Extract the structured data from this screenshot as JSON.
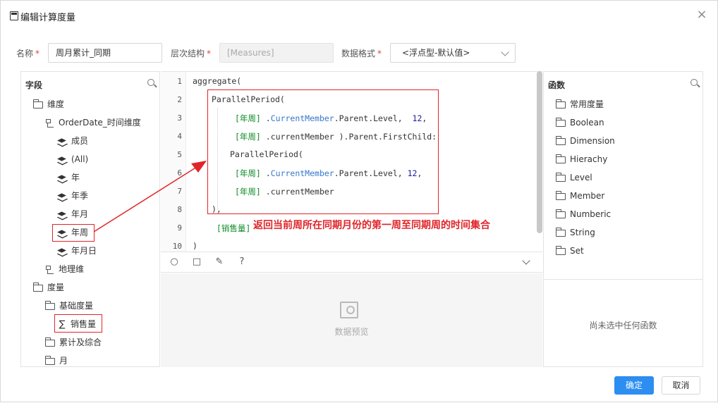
{
  "dialog": {
    "title": "编辑计算度量",
    "close": "×"
  },
  "form": {
    "name_label": "名称",
    "name_value": "周月累计_同期",
    "hier_label": "层次结构",
    "hier_value": "[Measures]",
    "format_label": "数据格式",
    "format_value": "<浮点型-默认值>",
    "required_mark": "*"
  },
  "fields_panel": {
    "title": "字段",
    "items": [
      {
        "label": "维度",
        "icon": "folder-icon"
      },
      {
        "label": "OrderDate_时间维度",
        "icon": "hierarchy-icon"
      },
      {
        "label": "成员",
        "icon": "layers-icon"
      },
      {
        "label": "(All)",
        "icon": "layers-icon"
      },
      {
        "label": "年",
        "icon": "layers-icon"
      },
      {
        "label": "年季",
        "icon": "layers-icon"
      },
      {
        "label": "年月",
        "icon": "layers-icon"
      },
      {
        "label": "年周",
        "icon": "layers-icon"
      },
      {
        "label": "年月日",
        "icon": "layers-icon"
      },
      {
        "label": "地理维",
        "icon": "hierarchy-icon"
      },
      {
        "label": "度量",
        "icon": "folder-icon"
      },
      {
        "label": "基础度量",
        "icon": "folder-icon"
      },
      {
        "label": "销售量",
        "icon": "sigma-icon"
      },
      {
        "label": "累计及综合",
        "icon": "folder-icon"
      },
      {
        "label": "月",
        "icon": "folder-icon"
      }
    ]
  },
  "editor": {
    "line_numbers": [
      "1",
      "2",
      "3",
      "4",
      "5",
      "6",
      "7",
      "8",
      "9",
      "10"
    ],
    "lines": {
      "l1": "aggregate(",
      "l2": "ParallelPeriod(",
      "l3a": "[年周]",
      "l3b": " .",
      "l3c": "CurrentMember",
      "l3d": ".Parent.Level,  ",
      "l3e": "12",
      "l3f": ",",
      "l4a": "[年周]",
      "l4b": " .currentMember ).Parent.FirstChild:",
      "l5": "ParallelPeriod(",
      "l6a": "[年周]",
      "l6b": " .",
      "l6c": "CurrentMember",
      "l6d": ".Parent.Level, ",
      "l6e": "12",
      "l6f": ",",
      "l7a": "[年周]",
      "l7b": " .currentMember",
      "l8": "),",
      "l9": "[销售量]",
      "l10": ")"
    }
  },
  "annotation": "返回当前周所在同期月份的第一周至同期周的时间集合",
  "preview": {
    "label": "数据预览"
  },
  "functions_panel": {
    "title": "函数",
    "items": [
      "常用度量",
      "Boolean",
      "Dimension",
      "Hierachy",
      "Level",
      "Member",
      "Numberic",
      "String",
      "Set"
    ],
    "empty_text": "尚未选中任何函数"
  },
  "buttons": {
    "ok": "确定",
    "cancel": "取消"
  },
  "colors": {
    "primary": "#2c8ef0",
    "highlight": "#e0252a",
    "keyword": "#0b8a26",
    "member": "#3377cc"
  }
}
